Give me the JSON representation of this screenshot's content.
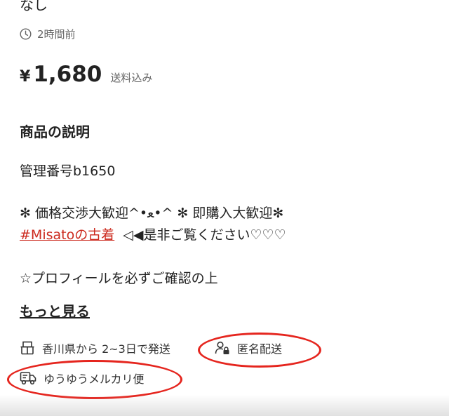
{
  "item": {
    "condition_value": "なし",
    "posted_time": "2時間前",
    "price": {
      "currency": "¥",
      "amount": "1,680",
      "shipping_note": "送料込み"
    }
  },
  "description": {
    "title": "商品の説明",
    "line1": "管理番号b1650",
    "line2": "✻ 価格交渉大歓迎^•ﻌ•^ ✻ 即購入大歓迎✻",
    "hashtag": "#Misatoの古着",
    "line3_rest": "  ◁◀是非ご覧ください♡♡♡",
    "line4": "☆プロフィールを必ずご確認の上",
    "more_label": "もっと見る"
  },
  "shipping": {
    "from": "香川県から 2~3日で発送",
    "anonymous": "匿名配送",
    "method": "ゆうゆうメルカリ便"
  },
  "icons": {
    "time": "clock-icon",
    "ship_from": "package-icon",
    "anonymous": "anonymous-user-icon",
    "method": "truck-icon"
  },
  "colors": {
    "hashtag": "#cc2a1e",
    "highlight": "#e5251e",
    "text_muted": "#666666"
  }
}
